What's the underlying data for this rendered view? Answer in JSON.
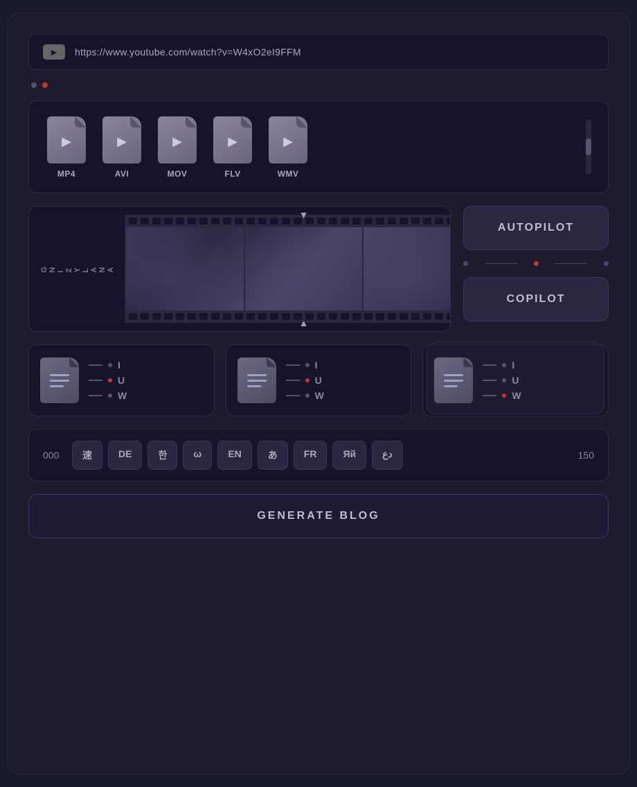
{
  "url_bar": {
    "url": "https://www.youtube.com/watch?v=W4xO2eI9FFM"
  },
  "format_panel": {
    "formats": [
      {
        "label": "MP4",
        "id": "mp4"
      },
      {
        "label": "AVI",
        "id": "avi"
      },
      {
        "label": "MOV",
        "id": "mov"
      },
      {
        "label": "FLV",
        "id": "flv"
      },
      {
        "label": "WMV",
        "id": "wmv"
      }
    ]
  },
  "analyzer": {
    "label": "A\nN\nA\nL\nY\nZ\nI\nN\nG"
  },
  "pilot_buttons": {
    "autopilot": "AUTOPILOT",
    "copilot": "COPILOT"
  },
  "doc_options": [
    {
      "id": "doc1",
      "format_options": [
        {
          "label": "I",
          "active": false
        },
        {
          "label": "U",
          "active": true
        },
        {
          "label": "W",
          "active": false
        }
      ]
    },
    {
      "id": "doc2",
      "format_options": [
        {
          "label": "I",
          "active": false
        },
        {
          "label": "U",
          "active": false
        },
        {
          "label": "W",
          "active": false
        }
      ]
    },
    {
      "id": "doc3",
      "format_options": [
        {
          "label": "I",
          "active": false
        },
        {
          "label": "U",
          "active": false
        },
        {
          "label": "W",
          "active": true
        }
      ]
    }
  ],
  "language_selector": {
    "min_count": "000",
    "max_count": "150",
    "languages": [
      {
        "label": "速",
        "id": "zh-fast"
      },
      {
        "label": "DE",
        "id": "de"
      },
      {
        "label": "한",
        "id": "ko"
      },
      {
        "label": "ω",
        "id": "omega"
      },
      {
        "label": "EN",
        "id": "en"
      },
      {
        "label": "あ",
        "id": "ja"
      },
      {
        "label": "FR",
        "id": "fr"
      },
      {
        "label": "Яй",
        "id": "ru"
      },
      {
        "label": "دع",
        "id": "ar"
      }
    ]
  },
  "generate_button": {
    "label": "GENERATE BLOG"
  }
}
